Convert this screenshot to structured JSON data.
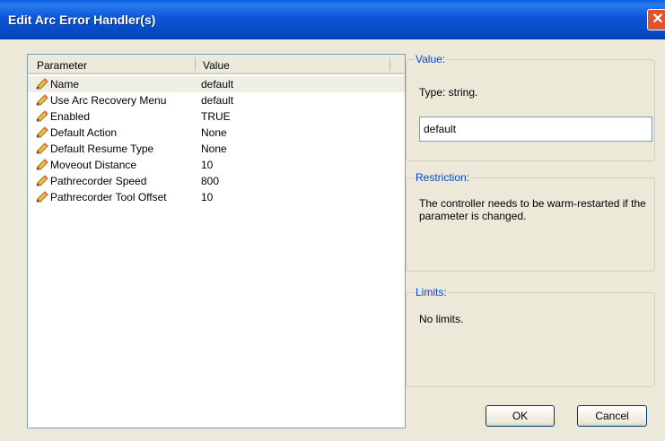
{
  "window": {
    "title": "Edit Arc Error Handler(s)",
    "close_glyph": "✕"
  },
  "list": {
    "headers": {
      "parameter": "Parameter",
      "value": "Value"
    },
    "rows": [
      {
        "name": "Name",
        "value": "default"
      },
      {
        "name": "Use Arc Recovery Menu",
        "value": "default"
      },
      {
        "name": "Enabled",
        "value": "TRUE"
      },
      {
        "name": "Default Action",
        "value": "None"
      },
      {
        "name": "Default Resume Type",
        "value": "None"
      },
      {
        "name": "Moveout Distance",
        "value": "10"
      },
      {
        "name": "Pathrecorder Speed",
        "value": "800"
      },
      {
        "name": "Pathrecorder Tool Offset",
        "value": "10"
      }
    ],
    "selected_index": 0,
    "row_icon": "pencil-icon"
  },
  "value_group": {
    "label": "Value:",
    "type_text": "Type: string.",
    "input_value": "default"
  },
  "restriction_group": {
    "label": "Restriction:",
    "text": "The controller needs to be warm-restarted if the parameter is changed."
  },
  "limits_group": {
    "label": "Limits:",
    "text": "No limits."
  },
  "buttons": {
    "ok": "OK",
    "cancel": "Cancel"
  },
  "colors": {
    "titlebar": "#0a55d8",
    "dialog_bg": "#ece9d8",
    "group_label": "#0046d5",
    "close_button": "#e0522b"
  }
}
